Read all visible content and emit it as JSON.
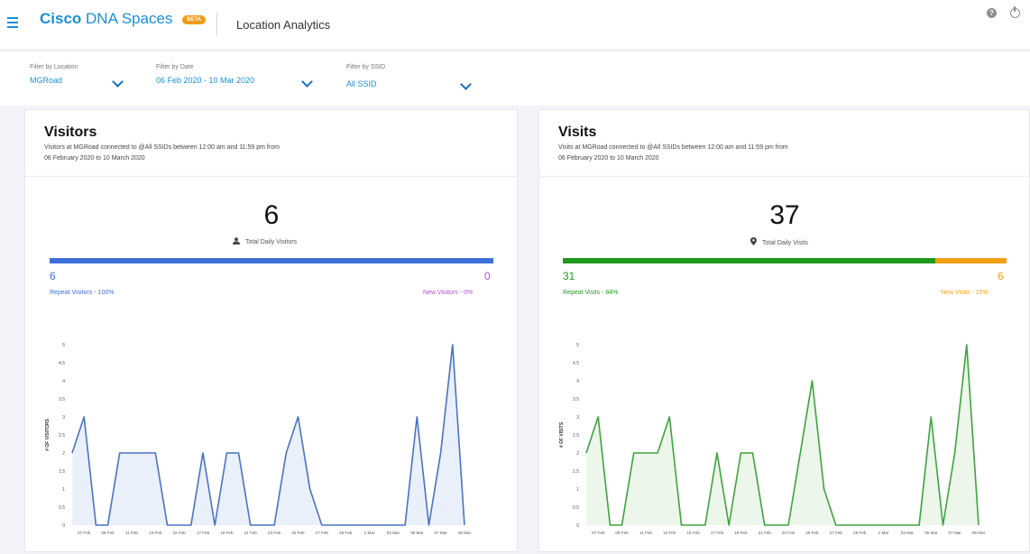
{
  "header": {
    "brand_bold": "Cisco",
    "brand_rest": "DNA Spaces",
    "beta_badge": "BETA",
    "app_title": "Location Analytics",
    "help_glyph": "?"
  },
  "filters": [
    {
      "label": "Filter by Location",
      "value": "MGRoad"
    },
    {
      "label": "Filter by Date",
      "value": "06 Feb 2020 - 10 Mar 2020"
    },
    {
      "label": "Filter by SSID",
      "value": "All SSID"
    }
  ],
  "x_ticks": [
    "07 Feb",
    "09 Feb",
    "11 Feb",
    "13 Feb",
    "15 Feb",
    "17 Feb",
    "19 Feb",
    "21 Feb",
    "23 Feb",
    "25 Feb",
    "27 Feb",
    "29 Feb",
    "1 Mar",
    "03 Mar",
    "05 Mar",
    "07 Mar",
    "09 Mar"
  ],
  "y_ticks": [
    "0",
    "0.5",
    "1",
    "1.5",
    "2",
    "2.5",
    "3",
    "3.5",
    "4",
    "4.5",
    "5"
  ],
  "visitors": {
    "title": "Visitors",
    "subtitle": "Visitors at MGRoad connected to @All SSIDs between 12:00 am and 11:59 pm from 06 February 2020 to 10 March 2020",
    "total": "6",
    "total_label": "Total Daily Visitors",
    "icon": "person-icon",
    "repeat_count": "6",
    "new_count": "0",
    "repeat_label": "Repeat Visitors - 100%",
    "new_label": "New Visitors - 0%",
    "repeat_fraction": 1.0,
    "colors": {
      "repeat": "#3f6fd8",
      "new": "#b04fd6",
      "line": "#4a72c6",
      "fill": "#eaf0fa"
    }
  },
  "visits": {
    "title": "Visits",
    "subtitle": "Visits at MGRoad connected to @All SSIDs between 12:00 am and 11:59 pm from 06 February 2020 to 10 March 2020",
    "total": "37",
    "total_label": "Total Daily Visits",
    "icon": "location-pin-icon",
    "repeat_count": "31",
    "new_count": "6",
    "repeat_label": "Repeat Visits - 84%",
    "new_label": "New Visits - 16%",
    "repeat_fraction": 0.84,
    "colors": {
      "repeat": "#1f9a1f",
      "new": "#f2a013",
      "line": "#3fa33f",
      "fill": "#ecf6ea"
    }
  },
  "chart_data": [
    {
      "type": "area",
      "ylabel": "# OF VISITORS",
      "ylim": [
        0,
        5
      ],
      "grid": false,
      "x": [
        "06 Feb",
        "07 Feb",
        "08 Feb",
        "09 Feb",
        "10 Feb",
        "11 Feb",
        "12 Feb",
        "13 Feb",
        "14 Feb",
        "15 Feb",
        "16 Feb",
        "17 Feb",
        "18 Feb",
        "19 Feb",
        "20 Feb",
        "21 Feb",
        "22 Feb",
        "23 Feb",
        "24 Feb",
        "25 Feb",
        "26 Feb",
        "27 Feb",
        "28 Feb",
        "29 Feb",
        "01 Mar",
        "02 Mar",
        "03 Mar",
        "04 Mar",
        "05 Mar",
        "06 Mar",
        "07 Mar",
        "08 Mar",
        "09 Mar",
        "10 Mar"
      ],
      "values": [
        2,
        3,
        0,
        0,
        2,
        2,
        2,
        2,
        0,
        0,
        0,
        2,
        0,
        2,
        2,
        0,
        0,
        0,
        2,
        3,
        1,
        0,
        0,
        0,
        0,
        0,
        0,
        0,
        0,
        3,
        0,
        2,
        5,
        0
      ]
    },
    {
      "type": "area",
      "ylabel": "# OF VISITS",
      "ylim": [
        0,
        5
      ],
      "grid": false,
      "x": [
        "06 Feb",
        "07 Feb",
        "08 Feb",
        "09 Feb",
        "10 Feb",
        "11 Feb",
        "12 Feb",
        "13 Feb",
        "14 Feb",
        "15 Feb",
        "16 Feb",
        "17 Feb",
        "18 Feb",
        "19 Feb",
        "20 Feb",
        "21 Feb",
        "22 Feb",
        "23 Feb",
        "24 Feb",
        "25 Feb",
        "26 Feb",
        "27 Feb",
        "28 Feb",
        "29 Feb",
        "01 Mar",
        "02 Mar",
        "03 Mar",
        "04 Mar",
        "05 Mar",
        "06 Mar",
        "07 Mar",
        "08 Mar",
        "09 Mar",
        "10 Mar"
      ],
      "values": [
        2,
        3,
        0,
        0,
        2,
        2,
        2,
        3,
        0,
        0,
        0,
        2,
        0,
        2,
        2,
        0,
        0,
        0,
        2,
        4,
        1,
        0,
        0,
        0,
        0,
        0,
        0,
        0,
        0,
        3,
        0,
        2,
        5,
        0
      ]
    }
  ]
}
